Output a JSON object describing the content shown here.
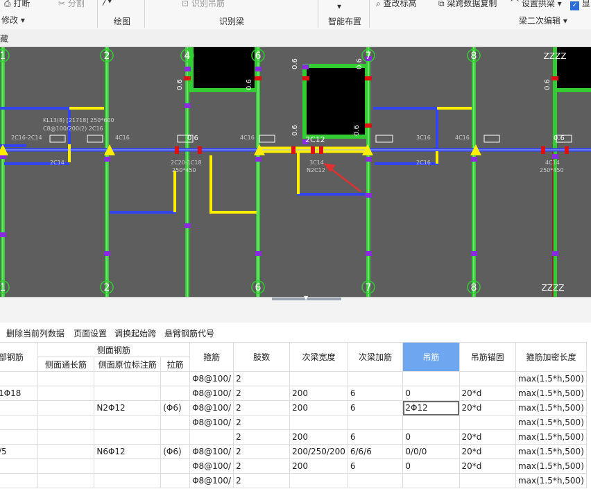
{
  "ribbon": {
    "print": "打断",
    "split": "分割",
    "modify": "修改",
    "draw": "绘图",
    "recognize_stirrup": "识别吊筋",
    "recognize_beam": "识别梁",
    "smart_layout": "智能布置",
    "check_height": "查改标高",
    "copy_span_data": "梁跨数据复制",
    "set_arch_beam": "设置拱梁",
    "show": "显",
    "beam_edit": "梁二次编辑"
  },
  "subbar": {
    "label": "藏"
  },
  "cad": {
    "axis_top": [
      "1",
      "2",
      "4",
      "6",
      "7",
      "8",
      "ZZZZ"
    ],
    "axis_bottom": [
      "1",
      "2",
      "6",
      "7",
      "8",
      "ZZZZ"
    ],
    "labels": {
      "beam_kl": "KL13(8) [21718] 250*600",
      "beam_kl2": "C8@100/200(2) 2C16",
      "left_top": "2C16-2C14",
      "left_bot": "2C14",
      "s4c16a": "4C16",
      "s4c16b": "4C16",
      "s2c20": "2C20-1C18",
      "s250a": "250*450",
      "s3c14": "3C14",
      "sn2c12": "N2C12",
      "s3c16": "3C16",
      "s4c16c": "4C16",
      "s2c16": "2C16",
      "s4c14": "4C14",
      "s250b": "250*450",
      "s2c12": "2C12",
      "zero6": "0.6"
    }
  },
  "toolbar": {
    "delete_col": "删除当前列数据",
    "page_setup": "页面设置",
    "swap_start": "调换起始跨",
    "cantilever_code": "悬臂钢筋代号"
  },
  "table": {
    "group_side": "侧面钢筋",
    "headers": {
      "bottom_rebar": "部钢筋",
      "side_through": "侧面通长筋",
      "side_original": "侧面原位标注筋",
      "tie_bar": "拉筋",
      "stirrup": "箍筋",
      "legs": "肢数",
      "sec_width": "次梁宽度",
      "sec_add": "次梁加筋",
      "hanger": "吊筋",
      "hanger_anchor": "吊筋锚固",
      "dense_len": "箍筋加密长度"
    },
    "rows": [
      [
        "",
        "",
        "",
        "",
        "Φ8@100/",
        "2",
        "",
        "",
        "",
        "",
        "max(1.5*h,500)"
      ],
      [
        "1Φ18",
        "",
        "",
        "",
        "Φ8@100/",
        "2",
        "200",
        "6",
        "0",
        "20*d",
        "max(1.5*h,500)"
      ],
      [
        "",
        "",
        "N2Φ12",
        "(Φ6)",
        "Φ8@100/",
        "2",
        "200",
        "6",
        "2Φ12",
        "20*d",
        "max(1.5*h,500)"
      ],
      [
        "",
        "",
        "",
        "",
        "Φ8@100/",
        "2",
        "",
        "",
        "",
        "",
        "max(1.5*h,500)"
      ],
      [
        "",
        "",
        "",
        "",
        "",
        "2",
        "200",
        "6",
        "0",
        "20*d",
        "max(1.5*h,500)"
      ],
      [
        "/5",
        "",
        "N6Φ12",
        "(Φ6)",
        "Φ8@100/",
        "2",
        "200/250/200",
        "6/6/6",
        "0/0/0",
        "20*d",
        "max(1.5*h,500)"
      ],
      [
        "",
        "",
        "",
        "",
        "Φ8@100/",
        "2",
        "200",
        "6",
        "0",
        "20*d",
        "max(1.5*h,500)"
      ],
      [
        "",
        "",
        "",
        "",
        "Φ8@100/",
        "2",
        "",
        "",
        "",
        "",
        "max(1.5*h,500)"
      ]
    ]
  },
  "colors": {
    "canvas": "#5e5e5e",
    "green": "#33cc33",
    "blue": "#3344ee",
    "yellow": "#ffee00",
    "purple": "#8a2be2",
    "red": "#dd1111",
    "active_header": "#6ea6f0"
  }
}
